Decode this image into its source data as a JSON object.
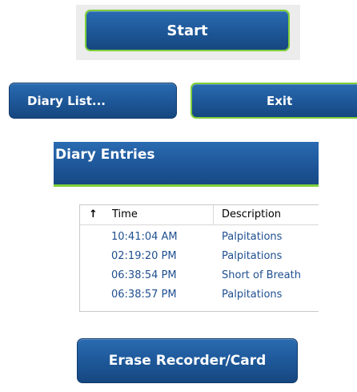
{
  "buttons": {
    "start_label": "Start",
    "diary_list_label": "Diary List...",
    "exit_label": "Exit",
    "erase_label": "Erase Recorder/Card"
  },
  "diary": {
    "title": "Diary Entries",
    "sort_arrow": "↑",
    "columns": {
      "time": "Time",
      "description": "Description"
    },
    "rows": [
      {
        "time": "10:41:04 AM",
        "description": "Palpitations"
      },
      {
        "time": "02:19:20 PM",
        "description": "Palpitations"
      },
      {
        "time": "06:38:54 PM",
        "description": "Short of Breath"
      },
      {
        "time": "06:38:57 PM",
        "description": "Palpitations"
      }
    ]
  },
  "colors": {
    "button_blue": "#1f5a9c",
    "focus_green": "#7fcf3a",
    "entry_text": "#1f4f8f"
  }
}
